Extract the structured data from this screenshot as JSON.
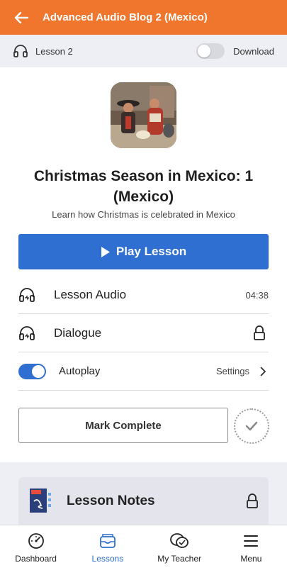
{
  "header": {
    "title": "Advanced Audio Blog 2 (Mexico)",
    "back_icon": "arrow-left-icon"
  },
  "subheader": {
    "lesson_label": "Lesson 2",
    "download_label": "Download",
    "download_enabled": false
  },
  "lesson": {
    "title": "Christmas Season in Mexico: 1 (Mexico)",
    "subtitle": "Learn how Christmas is celebrated in Mexico",
    "play_label": "Play Lesson"
  },
  "media": [
    {
      "label": "Lesson Audio",
      "duration": "04:38"
    },
    {
      "label": "Dialogue",
      "locked": true
    }
  ],
  "autoplay": {
    "label": "Autoplay",
    "enabled": true,
    "settings_label": "Settings"
  },
  "mark_complete": {
    "label": "Mark Complete"
  },
  "notes": {
    "label": "Lesson Notes",
    "locked": true
  },
  "tabs": [
    {
      "label": "Dashboard",
      "icon": "gauge-icon",
      "active": false
    },
    {
      "label": "Lessons",
      "icon": "inbox-icon",
      "active": true
    },
    {
      "label": "My Teacher",
      "icon": "chat-icon",
      "active": false
    },
    {
      "label": "Menu",
      "icon": "hamburger-icon",
      "active": false
    }
  ],
  "colors": {
    "brand": "#f0762e",
    "accent": "#2f6fd1"
  }
}
